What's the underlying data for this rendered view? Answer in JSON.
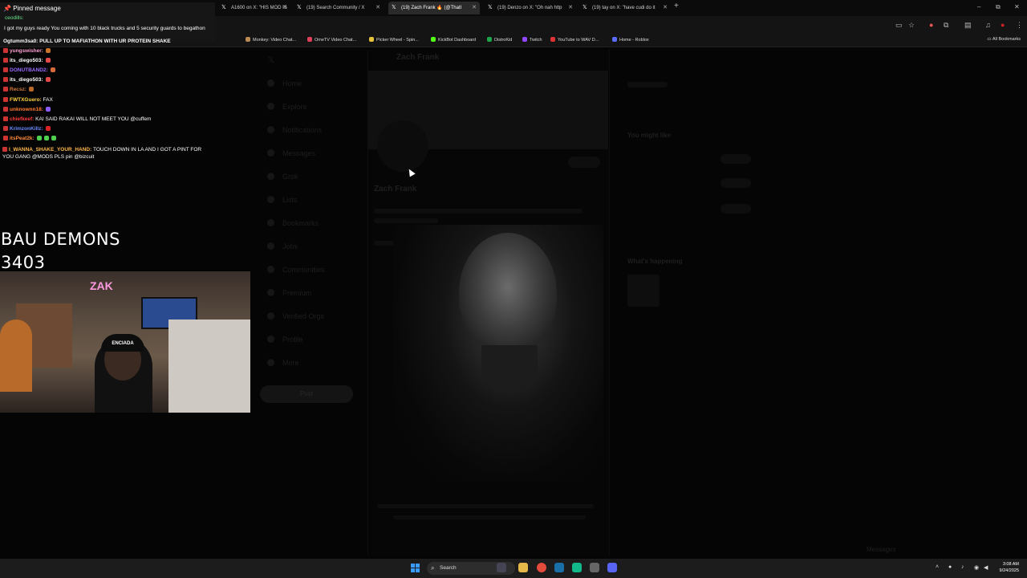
{
  "browser": {
    "tabs": [
      {
        "title": "A1600 on X: \"HIS MOD IS"
      },
      {
        "title": "(19) Search Community / X"
      },
      {
        "title": "(19) Zach Frank 🔥 (@ThatI"
      },
      {
        "title": "(19) Denzo on X: \"Oh nah http"
      },
      {
        "title": "(19) tay on X: \"have cudi do it"
      }
    ],
    "new_tab": "+",
    "window_controls": {
      "minimize": "–",
      "maximize": "⧉",
      "close": "✕"
    },
    "bookmarks": [
      {
        "label": "Monkey: Video Chat...",
        "color": "#b98a54"
      },
      {
        "label": "OmeTV Video Chat...",
        "color": "#e0405a"
      },
      {
        "label": "Picker Wheel - Spin...",
        "color": "#e8c13a"
      },
      {
        "label": "KickBot Dashboard",
        "color": "#53fc18"
      },
      {
        "label": "DistroKid",
        "color": "#1fa64b"
      },
      {
        "label": "Twitch",
        "color": "#9146ff"
      },
      {
        "label": "YouTube to WAV D...",
        "color": "#d33"
      },
      {
        "label": "Home - Roblox",
        "color": "#5a6cff"
      }
    ],
    "partial_bookmark": "Dashbo...",
    "all_bookmarks": "All Bookmarks"
  },
  "chat": {
    "pinned_header": "Pinned message",
    "pinned_user": "ceodills:",
    "pinned_text": "I got my guys ready You coming with 10 black trucks and 5 security guards to begathon",
    "partial_line": "Ogtumm3sa0: PULL UP TO MAFIATHON WITH UR PROTEIN SHAKE",
    "lines": [
      {
        "user": "yungswisher:",
        "text": "",
        "color": "#ff9fd1",
        "emote": "#c8722a"
      },
      {
        "user": "its_diego503:",
        "text": "",
        "color": "#ffffff",
        "emote": "#e24a4a"
      },
      {
        "user": "DONUTBAND2:",
        "text": "",
        "color": "#9a6bff",
        "emote": "#d86a3a"
      },
      {
        "user": "its_diego503:",
        "text": "",
        "color": "#ffffff",
        "emote": "#e24a4a"
      },
      {
        "user": "Recsz:",
        "text": "",
        "color": "#d07a3a",
        "emote": "#b86a2a"
      },
      {
        "user": "FWTXGuero:",
        "text": "FAX",
        "color": "#ffd23f",
        "emote": ""
      },
      {
        "user": "unknownn18:",
        "text": "",
        "color": "#ff7b2e",
        "emote": "#8a5cff"
      },
      {
        "user": "chiefkeef:",
        "text": "KAI SAID RAKAI WILL NOT MEET YOU @cuffem",
        "color": "#ff3b3b",
        "emote": ""
      },
      {
        "user": "KrimzonKillz:",
        "text": "",
        "color": "#6b8cff",
        "emote": "#d22"
      },
      {
        "user": "itsPeat2k:",
        "text": "",
        "color": "#ff8a3a",
        "emote": "#4fd14f"
      }
    ],
    "last_user": "I_WANNA_SHAKE_YOUR_HAND:",
    "last_user_color": "#ffb74d",
    "last_text": "TOUCH DOWN IN LA AND I GOT A PINT FOR YOU GANG @MODS PLS pin @bizcuit"
  },
  "overlay": {
    "line1": "BAU DEMONS",
    "line2": "3403",
    "cam_hat": "ENCIADA",
    "cam_neon": "ZAK"
  },
  "page": {
    "header_name": "Zach Frank",
    "profile_name": "Zach Frank",
    "nav": [
      "Home",
      "Explore",
      "Notifications",
      "Messages",
      "Grok",
      "Lists",
      "Bookmarks",
      "Jobs",
      "Communities",
      "Premium",
      "Verified Orgs",
      "Profile",
      "More"
    ],
    "post_button": "Post",
    "right_sidebar": {
      "you_might_like": "You might like",
      "whats_happening": "What's happening",
      "messages": "Messages"
    }
  },
  "taskbar": {
    "search_label": "Search",
    "time": "3:08 AM",
    "date": "9/24/2025",
    "icons": [
      {
        "name": "file-explorer-icon",
        "color": "#e6b84a"
      },
      {
        "name": "chrome-icon",
        "color": "#e34b3a"
      },
      {
        "name": "steam-icon",
        "color": "#1b6fa8"
      },
      {
        "name": "app-green-icon",
        "color": "#12b98a"
      },
      {
        "name": "app-gray-icon",
        "color": "#666"
      },
      {
        "name": "discord-icon",
        "color": "#5865f2"
      }
    ]
  }
}
